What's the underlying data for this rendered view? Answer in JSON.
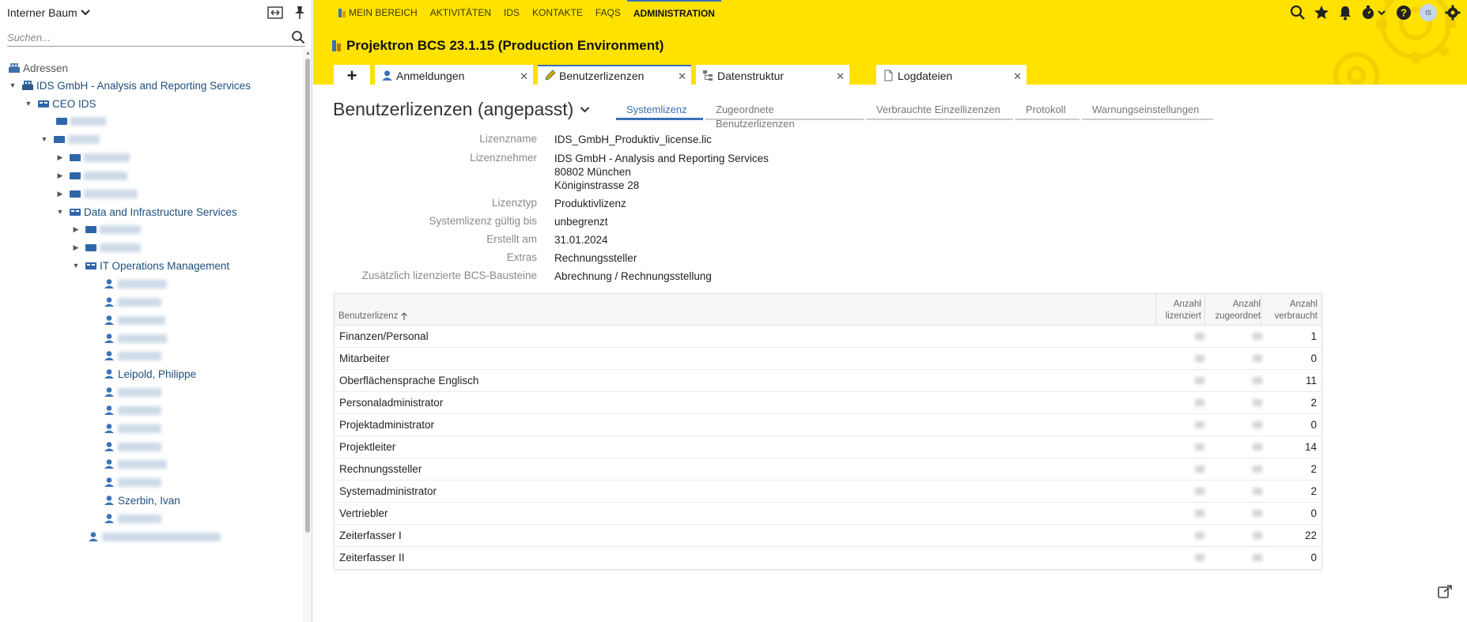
{
  "sidebar": {
    "title": "Interner Baum",
    "search_placeholder": "Suchen...",
    "tree": {
      "addresses": "Adressen",
      "company": "IDS GmbH - Analysis and Reporting Services",
      "ceo": "CEO IDS",
      "data_infra": "Data and Infrastructure Services",
      "it_ops": "IT Operations Management",
      "person1": "Leipold, Philippe",
      "person2": "Szerbin, Ivan"
    }
  },
  "header": {
    "nav": [
      "MEIN BEREICH",
      "AKTIVITÄTEN",
      "IDS",
      "KONTAKTE",
      "FAQS",
      "ADMINISTRATION"
    ],
    "avatar_initials": "IS",
    "env_title": "Projektron BCS 23.1.15 (Production Environment)",
    "tabs": [
      "Anmeldungen",
      "Benutzerlizenzen",
      "Datenstruktur",
      "Logdateien"
    ],
    "accent": "#ffe200",
    "active_color": "#3a70b5"
  },
  "main": {
    "title": "Benutzerlizenzen (angepasst)",
    "subtabs": [
      "Systemlizenz",
      "Zugeordnete Benutzerlizenzen",
      "Verbrauchte Einzellizenzen",
      "Protokoll",
      "Warnungseinstellungen"
    ],
    "details": {
      "lizenzname_label": "Lizenzname",
      "lizenzname": "IDS_GmbH_Produktiv_license.lic",
      "nehmer_label": "Lizenznehmer",
      "nehmer_line1": "IDS GmbH - Analysis and Reporting Services",
      "nehmer_line2": "80802 München",
      "nehmer_line3": "Königinstrasse 28",
      "typ_label": "Lizenztyp",
      "typ": "Produktivlizenz",
      "gueltig_label": "Systemlizenz gültig bis",
      "gueltig": "unbegrenzt",
      "erstellt_label": "Erstellt am",
      "erstellt": "31.01.2024",
      "extras_label": "Extras",
      "extras": "Rechnungssteller",
      "bausteine_label": "Zusätzlich lizenzierte BCS-Bausteine",
      "bausteine": "Abrechnung / Rechnungsstellung"
    },
    "table": {
      "col_name": "Benutzerlizenz",
      "col_lic_1": "Anzahl",
      "col_lic_2": "lizenziert",
      "col_zug_1": "Anzahl",
      "col_zug_2": "zugeordnet",
      "col_ver_1": "Anzahl",
      "col_ver_2": "verbraucht",
      "rows": [
        {
          "name": "Finanzen/Personal",
          "used": "1"
        },
        {
          "name": "Mitarbeiter",
          "used": "0"
        },
        {
          "name": "Oberflächensprache Englisch",
          "used": "11"
        },
        {
          "name": "Personaladministrator",
          "used": "2"
        },
        {
          "name": "Projektadministrator",
          "used": "0"
        },
        {
          "name": "Projektleiter",
          "used": "14"
        },
        {
          "name": "Rechnungssteller",
          "used": "2"
        },
        {
          "name": "Systemadministrator",
          "used": "2"
        },
        {
          "name": "Vertriebler",
          "used": "0"
        },
        {
          "name": "Zeiterfasser I",
          "used": "22"
        },
        {
          "name": "Zeiterfasser II",
          "used": "0"
        }
      ]
    }
  }
}
